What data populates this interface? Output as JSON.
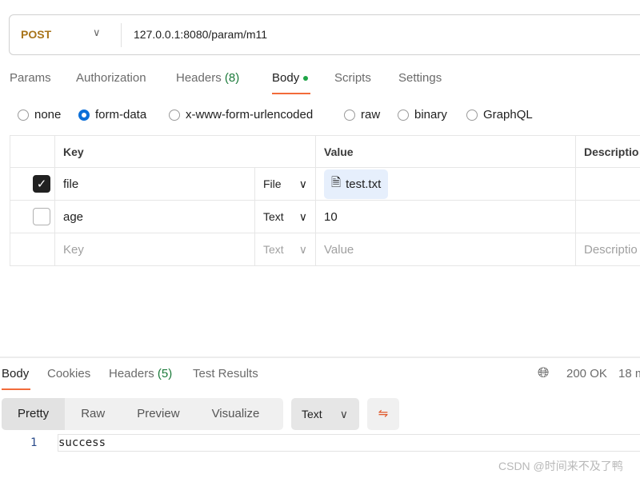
{
  "request": {
    "method": "POST",
    "url": "127.0.0.1:8080/param/m11"
  },
  "tabs": [
    {
      "label": "Params"
    },
    {
      "label": "Authorization"
    },
    {
      "label": "Headers",
      "count": "(8)"
    },
    {
      "label": "Body"
    },
    {
      "label": "Scripts"
    },
    {
      "label": "Settings"
    }
  ],
  "body_types": [
    "none",
    "form-data",
    "x-www-form-urlencoded",
    "raw",
    "binary",
    "GraphQL"
  ],
  "selected_body_type": "form-data",
  "table": {
    "headers": [
      "Key",
      "Value",
      "Descriptio"
    ],
    "rows": [
      {
        "checked": true,
        "key": "file",
        "type": "File",
        "value": "test.txt"
      },
      {
        "checked": false,
        "key": "age",
        "type": "Text",
        "value": "10"
      }
    ],
    "placeholder": {
      "key": "Key",
      "type": "Text",
      "value": "Value",
      "description": "Descriptio"
    }
  },
  "response": {
    "tabs": [
      {
        "label": "Body"
      },
      {
        "label": "Cookies"
      },
      {
        "label": "Headers",
        "count": "(5)"
      },
      {
        "label": "Test Results"
      }
    ],
    "status": "200 OK",
    "time": "18 m",
    "views": [
      "Pretty",
      "Raw",
      "Preview",
      "Visualize"
    ],
    "format": "Text",
    "line_number": "1",
    "content": "success"
  },
  "watermark": "CSDN @时间来不及了鸭",
  "colors": {
    "accent": "#f26b3a",
    "method": "#a8741a",
    "success": "#1b7a3a",
    "radio": "#0b6fd8"
  }
}
